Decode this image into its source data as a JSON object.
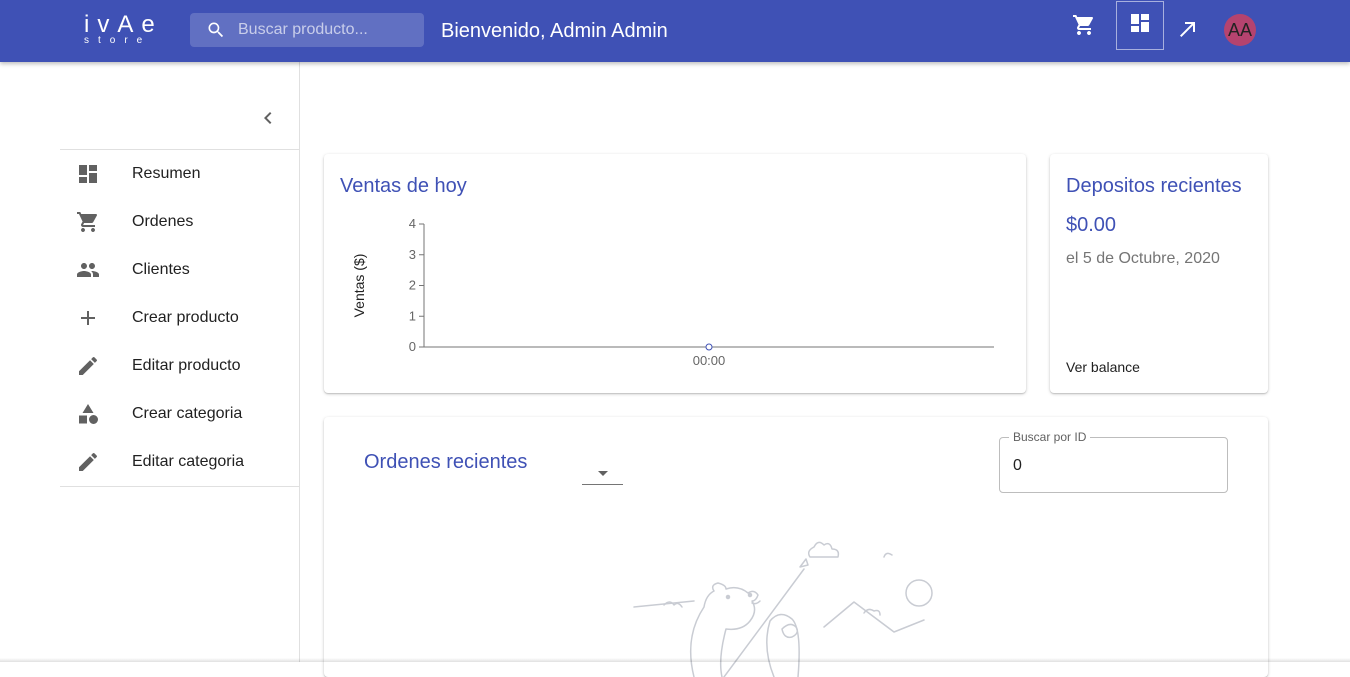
{
  "header": {
    "logo_main": "ivAe",
    "logo_sub": "store",
    "search_placeholder": "Buscar producto...",
    "welcome": "Bienvenido, Admin Admin",
    "avatar_initials": "AA",
    "icons": [
      "cart-icon",
      "dashboard-icon",
      "arrow-up-right-icon"
    ]
  },
  "sidebar": {
    "items": [
      {
        "label": "Resumen",
        "icon": "dashboard-icon"
      },
      {
        "label": "Ordenes",
        "icon": "cart-icon"
      },
      {
        "label": "Clientes",
        "icon": "people-icon"
      },
      {
        "label": "Crear producto",
        "icon": "plus-icon"
      },
      {
        "label": "Editar producto",
        "icon": "pencil-icon"
      },
      {
        "label": "Crear categoria",
        "icon": "shapes-icon"
      },
      {
        "label": "Editar categoria",
        "icon": "pencil-icon"
      }
    ]
  },
  "sales": {
    "title": "Ventas de hoy"
  },
  "deposits": {
    "title": "Depositos recientes",
    "amount": "$0.00",
    "date": "el 5 de Octubre, 2020",
    "link": "Ver balance"
  },
  "orders": {
    "title": "Ordenes recientes",
    "search_label": "Buscar por ID",
    "search_value": "0"
  },
  "colors": {
    "primary": "#3f51b5",
    "avatar": "#b5436f"
  },
  "chart_data": {
    "type": "line",
    "title": "",
    "xlabel": "",
    "ylabel": "Ventas ($)",
    "x": [
      "00:00"
    ],
    "series": [
      {
        "values": [
          0
        ]
      }
    ],
    "yticks": [
      0,
      1,
      2,
      3,
      4
    ],
    "ylim": [
      0,
      4
    ],
    "grid": false
  }
}
